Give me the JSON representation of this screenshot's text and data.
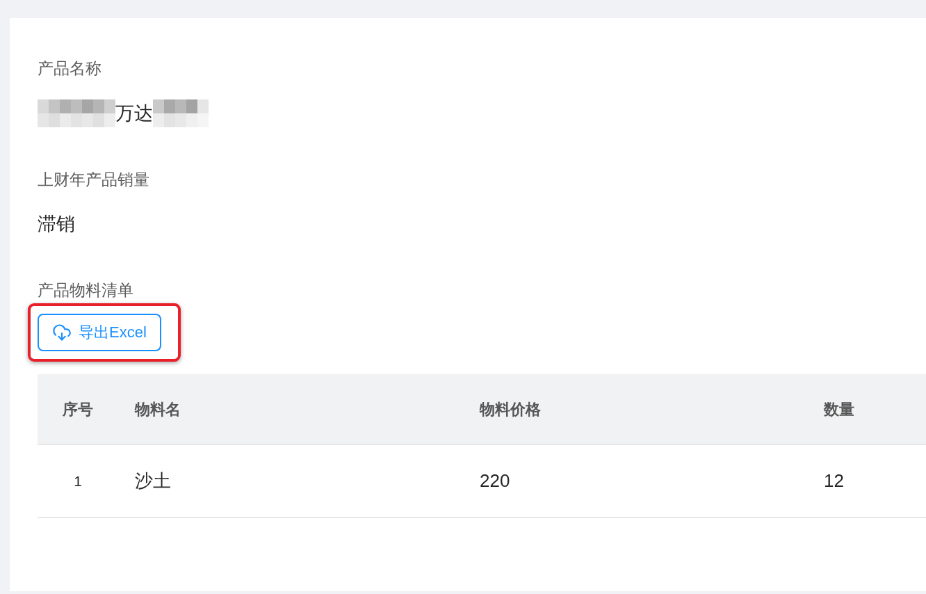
{
  "product_name": {
    "label": "产品名称",
    "parts": [
      {
        "kind": "redacted_long"
      },
      {
        "kind": "text",
        "text": "万达"
      },
      {
        "kind": "redacted_short"
      }
    ]
  },
  "sales": {
    "label": "上财年产品销量",
    "value": "滞销"
  },
  "materials": {
    "label": "产品物料清单",
    "export_button": {
      "label": "导出Excel",
      "highlighted": true
    },
    "table": {
      "columns": [
        "序号",
        "物料名",
        "物料价格",
        "数量"
      ],
      "rows": [
        [
          "1",
          "沙土",
          "220",
          "12"
        ]
      ]
    }
  }
}
